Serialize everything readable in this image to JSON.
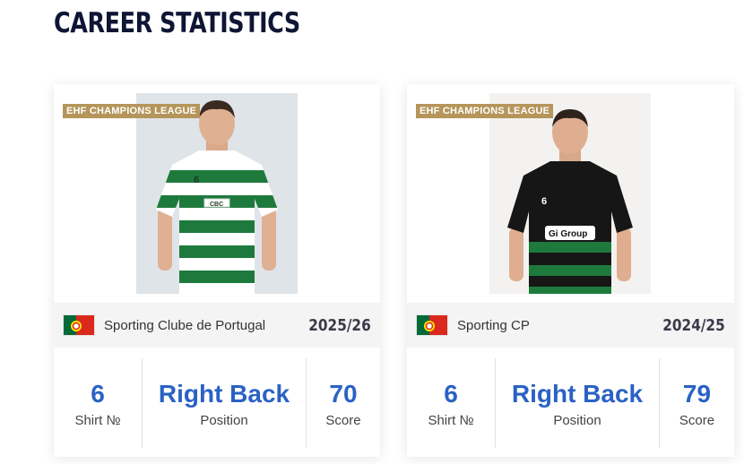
{
  "page": {
    "title": "CAREER STATISTICS"
  },
  "cards": [
    {
      "badge": "EHF CHAMPIONS LEAGUE",
      "photo_alt": "player-photo",
      "jersey": {
        "number": "6",
        "sponsor": "CBC",
        "style": "green-white-hoops"
      },
      "club": {
        "flag": "portugal-flag-icon",
        "name": "Sporting Clube de Portugal",
        "season": "2025/26"
      },
      "stats": [
        {
          "value": "6",
          "label": "Shirt №"
        },
        {
          "value": "Right Back",
          "label": "Position"
        },
        {
          "value": "70",
          "label": "Score"
        }
      ]
    },
    {
      "badge": "EHF CHAMPIONS LEAGUE",
      "photo_alt": "player-photo",
      "jersey": {
        "number": "6",
        "sponsor": "Gi Group",
        "style": "black-green-hoops"
      },
      "club": {
        "flag": "portugal-flag-icon",
        "name": "Sporting CP",
        "season": "2024/25"
      },
      "stats": [
        {
          "value": "6",
          "label": "Shirt №"
        },
        {
          "value": "Right Back",
          "label": "Position"
        },
        {
          "value": "79",
          "label": "Score"
        }
      ]
    }
  ],
  "colors": {
    "accent": "#2a62c4",
    "badge": "#b5955a",
    "title": "#0f1535",
    "green": "#1e7a3c"
  }
}
